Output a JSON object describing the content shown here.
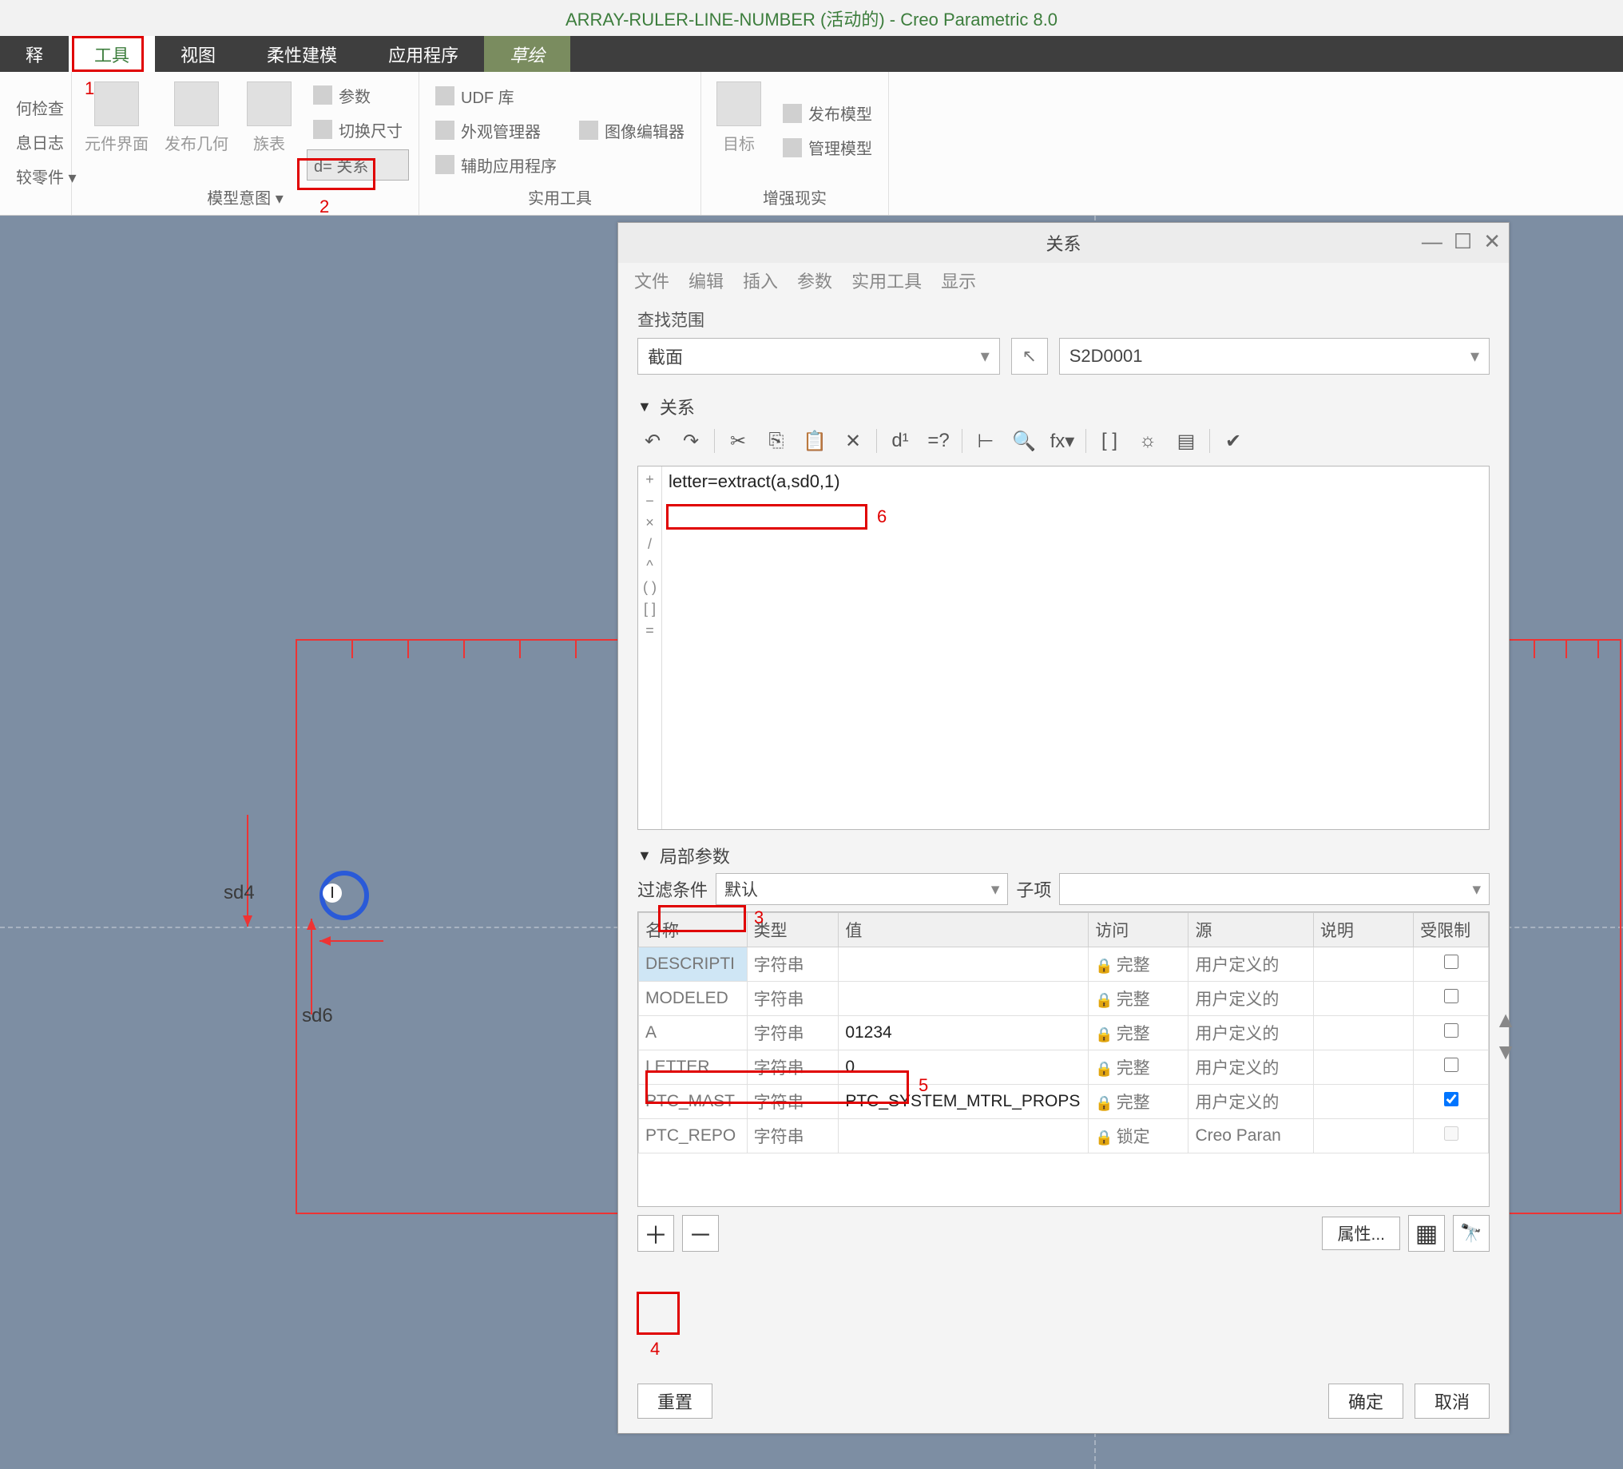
{
  "app": {
    "title": "ARRAY-RULER-LINE-NUMBER (活动的) - Creo Parametric 8.0"
  },
  "tabs": {
    "annotate": "释",
    "tools": "工具",
    "view": "视图",
    "flex": "柔性建模",
    "apps": "应用程序",
    "sketch": "草绘"
  },
  "ribbon": {
    "investigate": {
      "geom_check": "何检查",
      "msg_log": "息日志",
      "compare_part": "较零件 ▾"
    },
    "model_intent": {
      "comp_iface": "元件界面",
      "pub_geom": "发布几何",
      "family_tab": "族表",
      "parameters": "参数",
      "switch_dim": "切换尺寸",
      "relations": "d= 关系",
      "group_label": "模型意图 ▾"
    },
    "utilities": {
      "udf_lib": "UDF 库",
      "appearance_mgr": "外观管理器",
      "aux_apps": "辅助应用程序",
      "image_editor": "图像编辑器",
      "group_label": "实用工具"
    },
    "ar": {
      "target": "目标",
      "publish_model": "发布模型",
      "manage_model": "管理模型",
      "group_label": "增强现实"
    }
  },
  "sketch": {
    "dim1": "sd4",
    "dim2": "sd6"
  },
  "dialog": {
    "title": "关系",
    "menu": {
      "file": "文件",
      "edit": "编辑",
      "insert": "插入",
      "params": "参数",
      "util": "实用工具",
      "show": "显示"
    },
    "scope": {
      "label": "查找范围",
      "type": "截面",
      "name": "S2D0001"
    },
    "relations": {
      "label": "关系",
      "code": "letter=extract(a,sd0,1)"
    },
    "local_params": {
      "label": "局部参数",
      "filter_lbl": "过滤条件",
      "filter_val": "默认",
      "sub_lbl": "子项",
      "sub_val": "",
      "cols": {
        "name": "名称",
        "type": "类型",
        "value": "值",
        "access": "访问",
        "source": "源",
        "desc": "说明",
        "restricted": "受限制"
      },
      "rows": [
        {
          "name": "DESCRIPTI",
          "type": "字符串",
          "value": "",
          "access": "完整",
          "source": "用户定义的",
          "desc": "",
          "restricted": false,
          "locked": false
        },
        {
          "name": "MODELED",
          "type": "字符串",
          "value": "",
          "access": "完整",
          "source": "用户定义的",
          "desc": "",
          "restricted": false,
          "locked": false
        },
        {
          "name": "A",
          "type": "字符串",
          "value": "01234",
          "access": "完整",
          "source": "用户定义的",
          "desc": "",
          "restricted": false,
          "locked": false
        },
        {
          "name": "LETTER",
          "type": "字符串",
          "value": "0",
          "access": "完整",
          "source": "用户定义的",
          "desc": "",
          "restricted": false,
          "locked": false
        },
        {
          "name": "PTC_MAST",
          "type": "字符串",
          "value": "PTC_SYSTEM_MTRL_PROPS",
          "access": "完整",
          "source": "用户定义的",
          "desc": "",
          "restricted": true,
          "locked": false
        },
        {
          "name": "PTC_REPO",
          "type": "字符串",
          "value": "",
          "access": "锁定",
          "source": "Creo Paran",
          "desc": "",
          "restricted": false,
          "locked": true
        }
      ],
      "props_btn": "属性..."
    },
    "footer": {
      "reset": "重置",
      "ok": "确定",
      "cancel": "取消"
    }
  },
  "callouts": {
    "c1": "1",
    "c2": "2",
    "c3": "3",
    "c4": "4",
    "c5": "5",
    "c6": "6"
  }
}
